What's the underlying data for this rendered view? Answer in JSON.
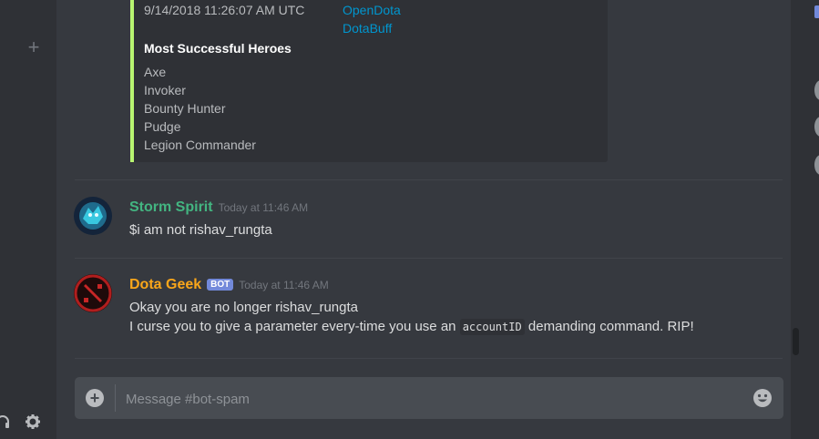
{
  "sidebar": {
    "add_icon": "plus-icon",
    "headphones_icon": "headphones-icon",
    "settings_icon": "gear-icon"
  },
  "embed": {
    "timestamp": "9/14/2018 11:26:07 AM UTC",
    "links": [
      "OpenDota",
      "DotaBuff"
    ],
    "section_title": "Most Successful Heroes",
    "heroes": [
      "Axe",
      "Invoker",
      "Bounty Hunter",
      "Pudge",
      "Legion Commander"
    ],
    "accent_color": "#b8f571"
  },
  "messages": [
    {
      "author": "Storm Spirit",
      "author_color": "#43b581",
      "time": "Today at 11:46 AM",
      "text": "$i am not rishav_rungta"
    },
    {
      "author": "Dota Geek",
      "author_color": "#faa61a",
      "badge": "BOT",
      "time": "Today at 11:46 AM",
      "line1": "Okay you are no longer rishav_rungta",
      "line2_before": "I curse you to give a parameter every-time you use an",
      "line2_code": "accountID",
      "line2_after": "demanding command. RIP!"
    }
  ],
  "composer": {
    "placeholder": "Message #bot-spam",
    "value": "",
    "attach_icon": "plus-circle-icon",
    "emoji_icon": "emoji-icon"
  }
}
